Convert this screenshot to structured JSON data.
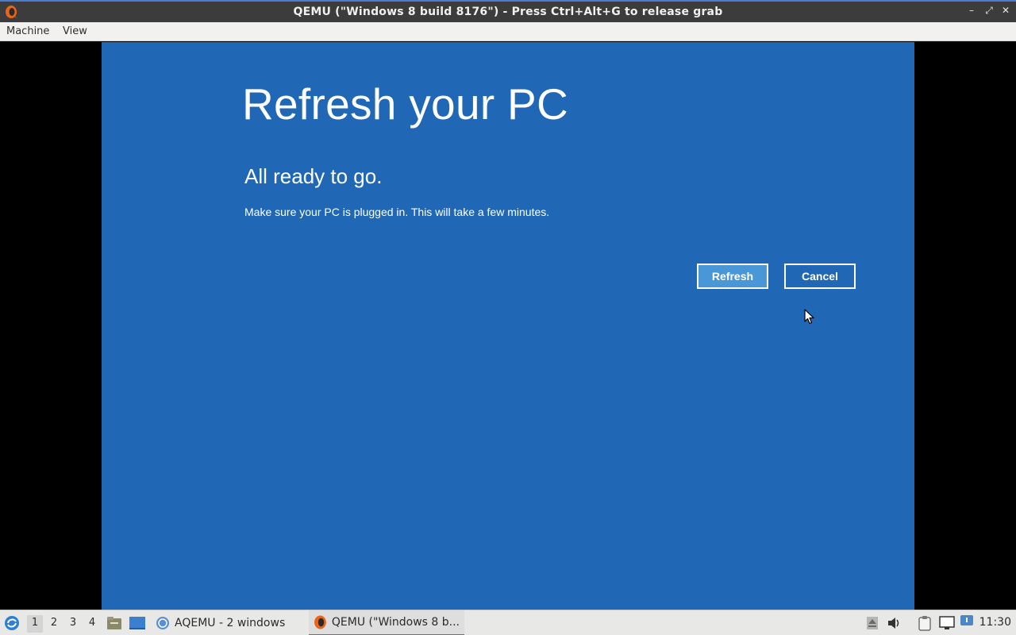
{
  "window": {
    "title": "QEMU (\"Windows 8 build 8176\") - Press Ctrl+Alt+G to release grab",
    "icon": "qemu-icon",
    "controls": {
      "minimize": "–",
      "restore": "⤢",
      "close": "✕"
    }
  },
  "menubar": {
    "items": [
      {
        "label": "Machine"
      },
      {
        "label": "View"
      }
    ]
  },
  "guest": {
    "background_color": "#2067b5",
    "heading": "Refresh your PC",
    "subheading": "All ready to go.",
    "message": "Make sure your PC is plugged in. This will take a few minutes.",
    "buttons": {
      "refresh": "Refresh",
      "cancel": "Cancel"
    }
  },
  "taskbar": {
    "start_icon": "lxqt-start-icon",
    "workspaces": [
      "1",
      "2",
      "3",
      "4"
    ],
    "active_workspace": "1",
    "quicklaunch": [
      "file-manager-icon",
      "desktop-icon"
    ],
    "tasks": [
      {
        "label": "AQEMU - 2 windows",
        "icon": "aqemu-icon",
        "active": false
      },
      {
        "label": "QEMU (\"Windows 8 b...",
        "icon": "qemu-icon",
        "active": true
      }
    ],
    "tray": [
      "eject-icon",
      "volume-icon",
      "clipboard-icon",
      "network-icon",
      "notification-icon"
    ],
    "clock": "11:30"
  }
}
